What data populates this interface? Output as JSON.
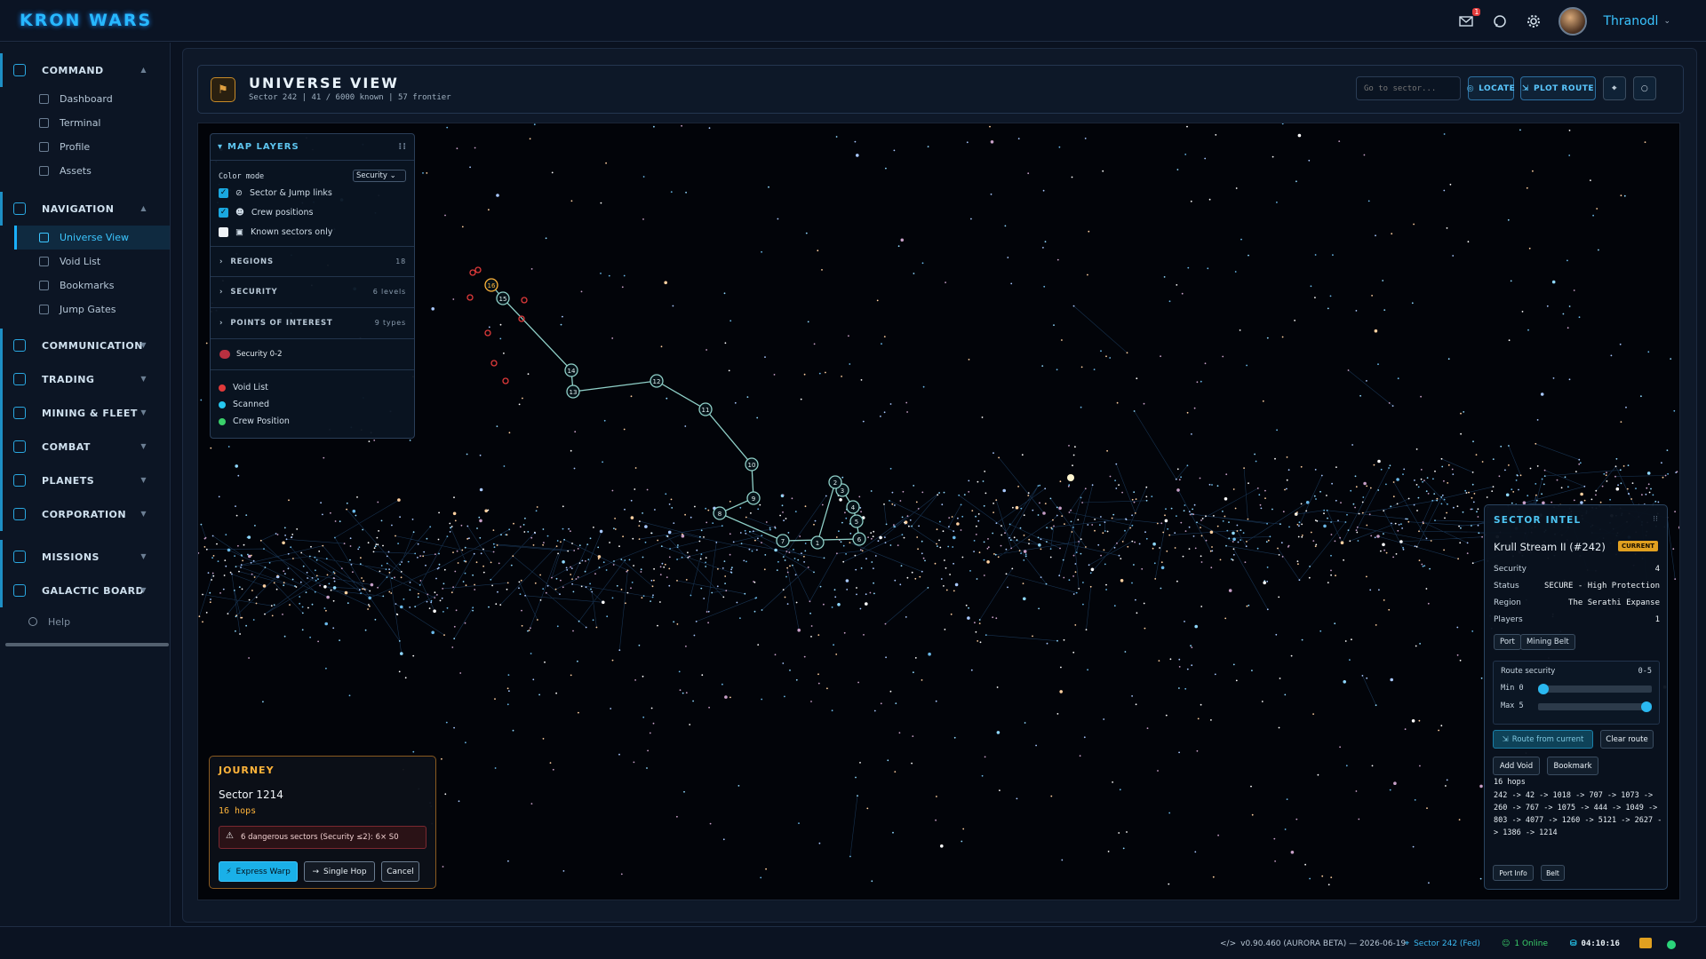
{
  "app": {
    "title": "KRON WARS"
  },
  "topbar": {
    "mail_count": "1",
    "username": "Thranodl"
  },
  "sidebar": {
    "sections": [
      {
        "label": "COMMAND",
        "items": [
          "Dashboard",
          "Terminal",
          "Profile",
          "Assets"
        ]
      },
      {
        "label": "NAVIGATION",
        "items": [
          "Universe View",
          "Void List",
          "Bookmarks",
          "Jump Gates"
        ]
      },
      {
        "label": "COMMUNICATION"
      },
      {
        "label": "TRADING"
      },
      {
        "label": "MINING & FLEET"
      },
      {
        "label": "COMBAT"
      },
      {
        "label": "PLANETS"
      },
      {
        "label": "CORPORATION"
      },
      {
        "label": "MISSIONS"
      },
      {
        "label": "GALACTIC BOARD"
      }
    ],
    "help": "Help"
  },
  "header": {
    "title": "UNIVERSE VIEW",
    "subtitle": "Sector 242 | 41 / 6000 known | 57 frontier",
    "goto_placeholder": "Go to sector...",
    "locate": "LOCATE",
    "plot_route": "PLOT ROUTE"
  },
  "layers": {
    "title": "MAP LAYERS",
    "color_mode_label": "Color mode",
    "color_mode_value": "Security",
    "toggles": [
      {
        "label": "Sector & Jump links",
        "checked": true
      },
      {
        "label": "Crew positions",
        "checked": true
      },
      {
        "label": "Known sectors only",
        "checked": false
      }
    ],
    "sections": [
      {
        "label": "REGIONS",
        "count": "18"
      },
      {
        "label": "SECURITY",
        "count": "6 levels"
      },
      {
        "label": "POINTS OF INTEREST",
        "count": "9 types"
      }
    ],
    "security_label": "Security 0-2",
    "legend": [
      {
        "label": "Void List",
        "color": "#e03a3a"
      },
      {
        "label": "Scanned",
        "color": "#26c8f0"
      },
      {
        "label": "Crew Position",
        "color": "#3ad06a"
      }
    ]
  },
  "journey": {
    "title": "JOURNEY",
    "sector": "Sector 1214",
    "hops": "16 hops",
    "warning": "6 dangerous sectors (Security ≤2): 6× S0",
    "express": "Express Warp",
    "single": "Single Hop",
    "cancel": "Cancel"
  },
  "intel": {
    "title": "SECTOR INTEL",
    "name": "Krull Stream II (#242)",
    "current": "CURRENT",
    "rows": [
      {
        "k": "Security",
        "v": "4"
      },
      {
        "k": "Status",
        "v": "SECURE - High Protection"
      },
      {
        "k": "Region",
        "v": "The Serathi Expanse"
      },
      {
        "k": "Players",
        "v": "1"
      }
    ],
    "tags": [
      "Port",
      "Mining Belt"
    ],
    "route_security": "Route security",
    "route_range": "0-5",
    "min_label": "Min 0",
    "max_label": "Max 5",
    "min_value": 0,
    "max_value": 5,
    "route_from": "Route from current",
    "clear_route": "Clear route",
    "add_void": "Add Void",
    "bookmark": "Bookmark",
    "path_hops": "16 hops",
    "path": "242 -> 42 -> 1018 -> 707 -> 1073 -> 260 -> 767 -> 1075 -> 444 -> 1049 -> 803 -> 4077 -> 1260 -> 5121 -> 2627 -> 1386 -> 1214",
    "port_info": "Port Info",
    "belt": "Belt"
  },
  "route_nodes": [
    "16",
    "15",
    "14",
    "13",
    "12",
    "11",
    "10",
    "9",
    "8",
    "7",
    "6",
    "5",
    "4",
    "3",
    "2",
    "1"
  ],
  "footer": {
    "version": "v0.90.460 (AURORA BETA) — 2026-06-19",
    "sector": "Sector 242 (Fed)",
    "online": "1 Online",
    "time": "04:10:16"
  },
  "colors": {
    "accent": "#27b8ff",
    "warning": "#ffb43a",
    "danger": "#e03a3a",
    "route": "#8fd0c8"
  }
}
